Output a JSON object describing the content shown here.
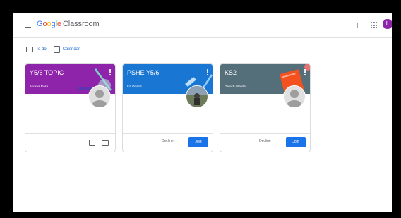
{
  "header": {
    "logo_google": [
      "G",
      "o",
      "o",
      "g",
      "l",
      "e"
    ],
    "product": "Classroom",
    "avatar_letter": "L",
    "plus_symbol": "+"
  },
  "subnav": {
    "todo_label": "To do",
    "calendar_label": "Calendar"
  },
  "cards": [
    {
      "title": "Y5/6 TOPIC",
      "owner": "Andrea Rose",
      "color": "#8e24aa"
    },
    {
      "title": "PSHE Y5/6",
      "owner": "Liz Orland",
      "color": "#1976d2",
      "decline": "Decline",
      "join": "Join"
    },
    {
      "title": "KS2",
      "owner": "Getech Wonde",
      "color": "#546e7a",
      "decline": "Decline",
      "join": "Join"
    }
  ]
}
